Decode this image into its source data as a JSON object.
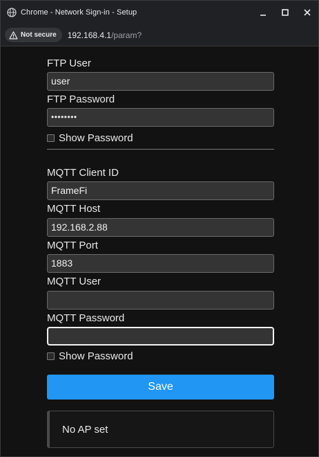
{
  "window": {
    "title": "Chrome - Network Sign-in - Setup",
    "controls": [
      "minimize-icon",
      "maximize-icon",
      "close-icon"
    ]
  },
  "address": {
    "security": "Not secure",
    "host": "192.168.4.1",
    "path": "/param?"
  },
  "ftp": {
    "user_label": "FTP User",
    "user_value": "user",
    "password_label": "FTP Password",
    "password_value": "••••••••",
    "show_password_label": "Show Password"
  },
  "mqtt": {
    "client_id_label": "MQTT Client ID",
    "client_id_value": "FrameFi",
    "host_label": "MQTT Host",
    "host_value": "192.168.2.88",
    "port_label": "MQTT Port",
    "port_value": "1883",
    "user_label": "MQTT User",
    "user_value": "",
    "password_label": "MQTT Password",
    "password_value": "",
    "show_password_label": "Show Password"
  },
  "actions": {
    "save_label": "Save"
  },
  "status": {
    "message": "No AP set"
  },
  "colors": {
    "accent": "#2196f3",
    "background": "#121212",
    "input_bg": "#343434"
  }
}
